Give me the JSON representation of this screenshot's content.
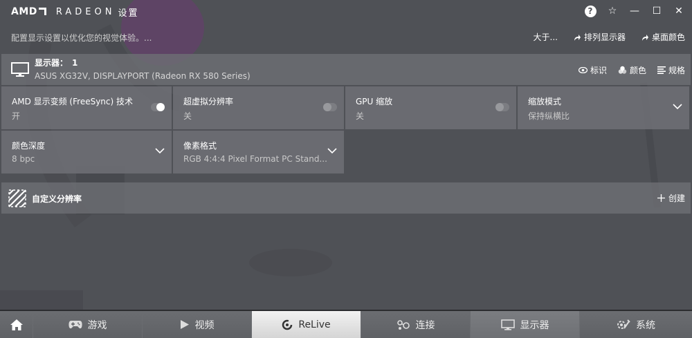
{
  "app": {
    "brand": "AMD",
    "product": "RADEON",
    "settings_word": "设置"
  },
  "header": {
    "hint": "配置显示设置以优化您的视觉体验。...",
    "about": "大于...",
    "arrange_displays": "排列显示器",
    "desktop_color": "桌面颜色"
  },
  "display": {
    "title_prefix": "显示器：",
    "number": "1",
    "subtitle": "ASUS XG32V, DISPLAYPORT (Radeon RX 580 Series)",
    "actions": {
      "identify": "标识",
      "color": "颜色",
      "specs": "规格"
    }
  },
  "tiles": {
    "freesync": {
      "label": "AMD 显示变频 (FreeSync) 技术",
      "value": "开",
      "state": "on"
    },
    "vsr": {
      "label": "超虚拟分辨率",
      "value": "关",
      "state": "off"
    },
    "gpu_scaling": {
      "label": "GPU 缩放",
      "value": "关",
      "state": "off"
    },
    "scaling_mode": {
      "label": "缩放模式",
      "value": "保持纵横比"
    },
    "color_depth": {
      "label": "颜色深度",
      "value": "8 bpc"
    },
    "pixel_format": {
      "label": "像素格式",
      "value": "RGB 4:4:4 Pixel Format PC Stand..."
    }
  },
  "custom_resolution": {
    "title": "自定义分辨率",
    "create": "创建"
  },
  "nav": {
    "games": "游戏",
    "video": "视频",
    "relive": "ReLive",
    "connect": "连接",
    "display": "显示器",
    "system": "系统",
    "active": "display"
  },
  "colors": {
    "background": "#4f5156",
    "panel": "#6e7075",
    "accent_bg_art": "#6b3a72",
    "relive_tab": "#e6e6e6"
  },
  "icons": {
    "help": "?",
    "favorite": "☆",
    "minimize": "—",
    "maximize": "☐",
    "close": "✕"
  }
}
